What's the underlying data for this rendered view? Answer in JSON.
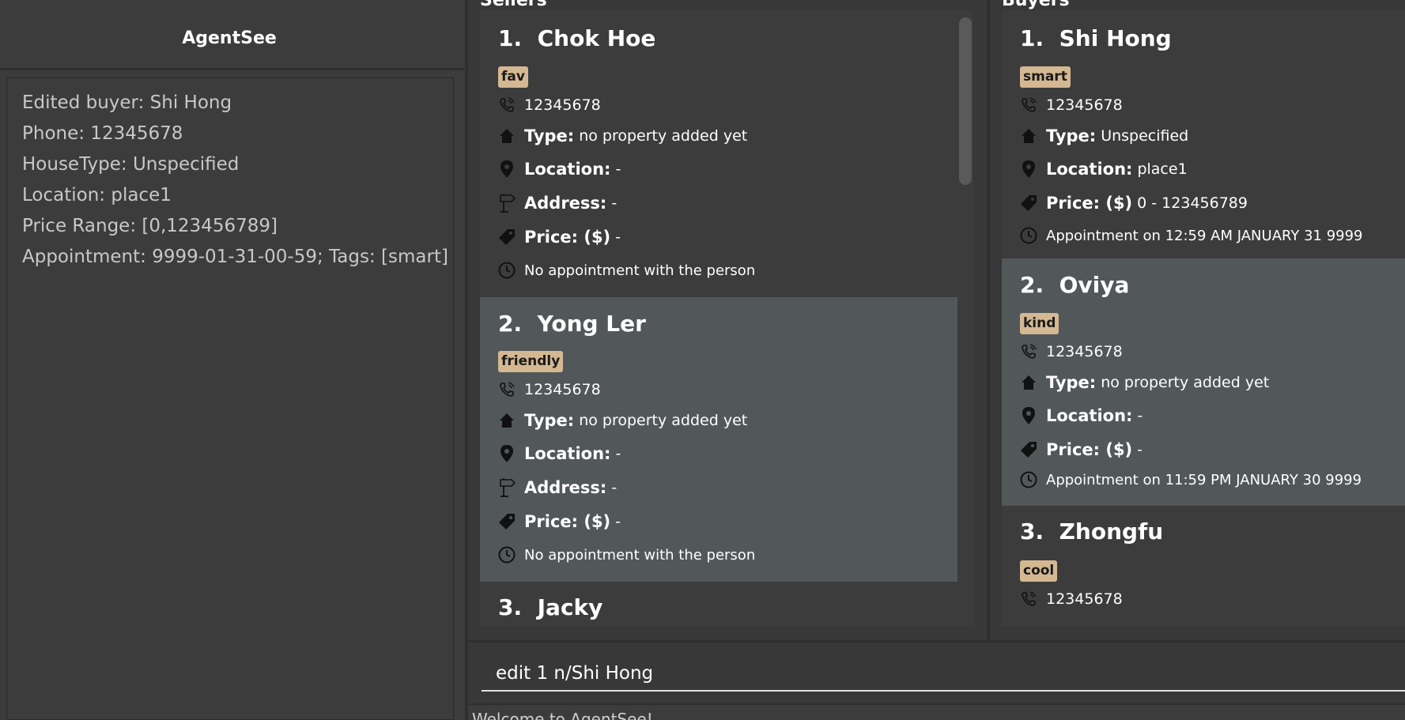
{
  "app": {
    "title": "AgentSee"
  },
  "result_display": {
    "lines": [
      "Edited buyer: Shi Hong",
      "Phone: 12345678",
      "HouseType: Unspecified",
      "Location: place1",
      "Price Range: [0,123456789]",
      "Appointment: 9999-01-31-00-59; Tags: [smart]"
    ]
  },
  "sellers": {
    "header": "Sellers",
    "cards": [
      {
        "index": "1.",
        "name": "Chok Hoe",
        "tag": "fav",
        "phone": "12345678",
        "type_label": "Type:",
        "type": "no property added yet",
        "location_label": "Location:",
        "location": "-",
        "address_label": "Address:",
        "address": "-",
        "price_label": "Price: ($)",
        "price": "-",
        "appointment": "No appointment with the person"
      },
      {
        "index": "2.",
        "name": "Yong Ler",
        "tag": "friendly",
        "phone": "12345678",
        "type_label": "Type:",
        "type": "no property added yet",
        "location_label": "Location:",
        "location": "-",
        "address_label": "Address:",
        "address": "-",
        "price_label": "Price: ($)",
        "price": "-",
        "appointment": "No appointment with the person"
      },
      {
        "index": "3.",
        "name": "Jacky"
      }
    ]
  },
  "buyers": {
    "header": "Buyers",
    "cards": [
      {
        "index": "1.",
        "name": "Shi Hong",
        "tag": "smart",
        "phone": "12345678",
        "type_label": "Type:",
        "type": "Unspecified",
        "location_label": "Location:",
        "location": "place1",
        "price_label": "Price: ($)",
        "price": "0 - 123456789",
        "appointment": "Appointment on 12:59 AM JANUARY 31 9999"
      },
      {
        "index": "2.",
        "name": "Oviya",
        "tag": "kind",
        "phone": "12345678",
        "type_label": "Type:",
        "type": "no property added yet",
        "location_label": "Location:",
        "location": "-",
        "price_label": "Price: ($)",
        "price": "-",
        "appointment": "Appointment on 11:59 PM JANUARY 30 9999"
      },
      {
        "index": "3.",
        "name": "Zhongfu",
        "tag": "cool",
        "phone": "12345678"
      }
    ]
  },
  "command_box": {
    "value": "edit 1 n/Shi Hong"
  },
  "status_bar": {
    "text": "Welcome to AgentSee!"
  },
  "icons": [
    "phone-icon",
    "house-icon",
    "location-pin-icon",
    "signpost-icon",
    "price-tag-icon",
    "clock-icon"
  ],
  "colors": {
    "background": "#3c3c3c",
    "selected_card": "#52575a",
    "tag": "#d4b892",
    "text": "#ffffff"
  }
}
